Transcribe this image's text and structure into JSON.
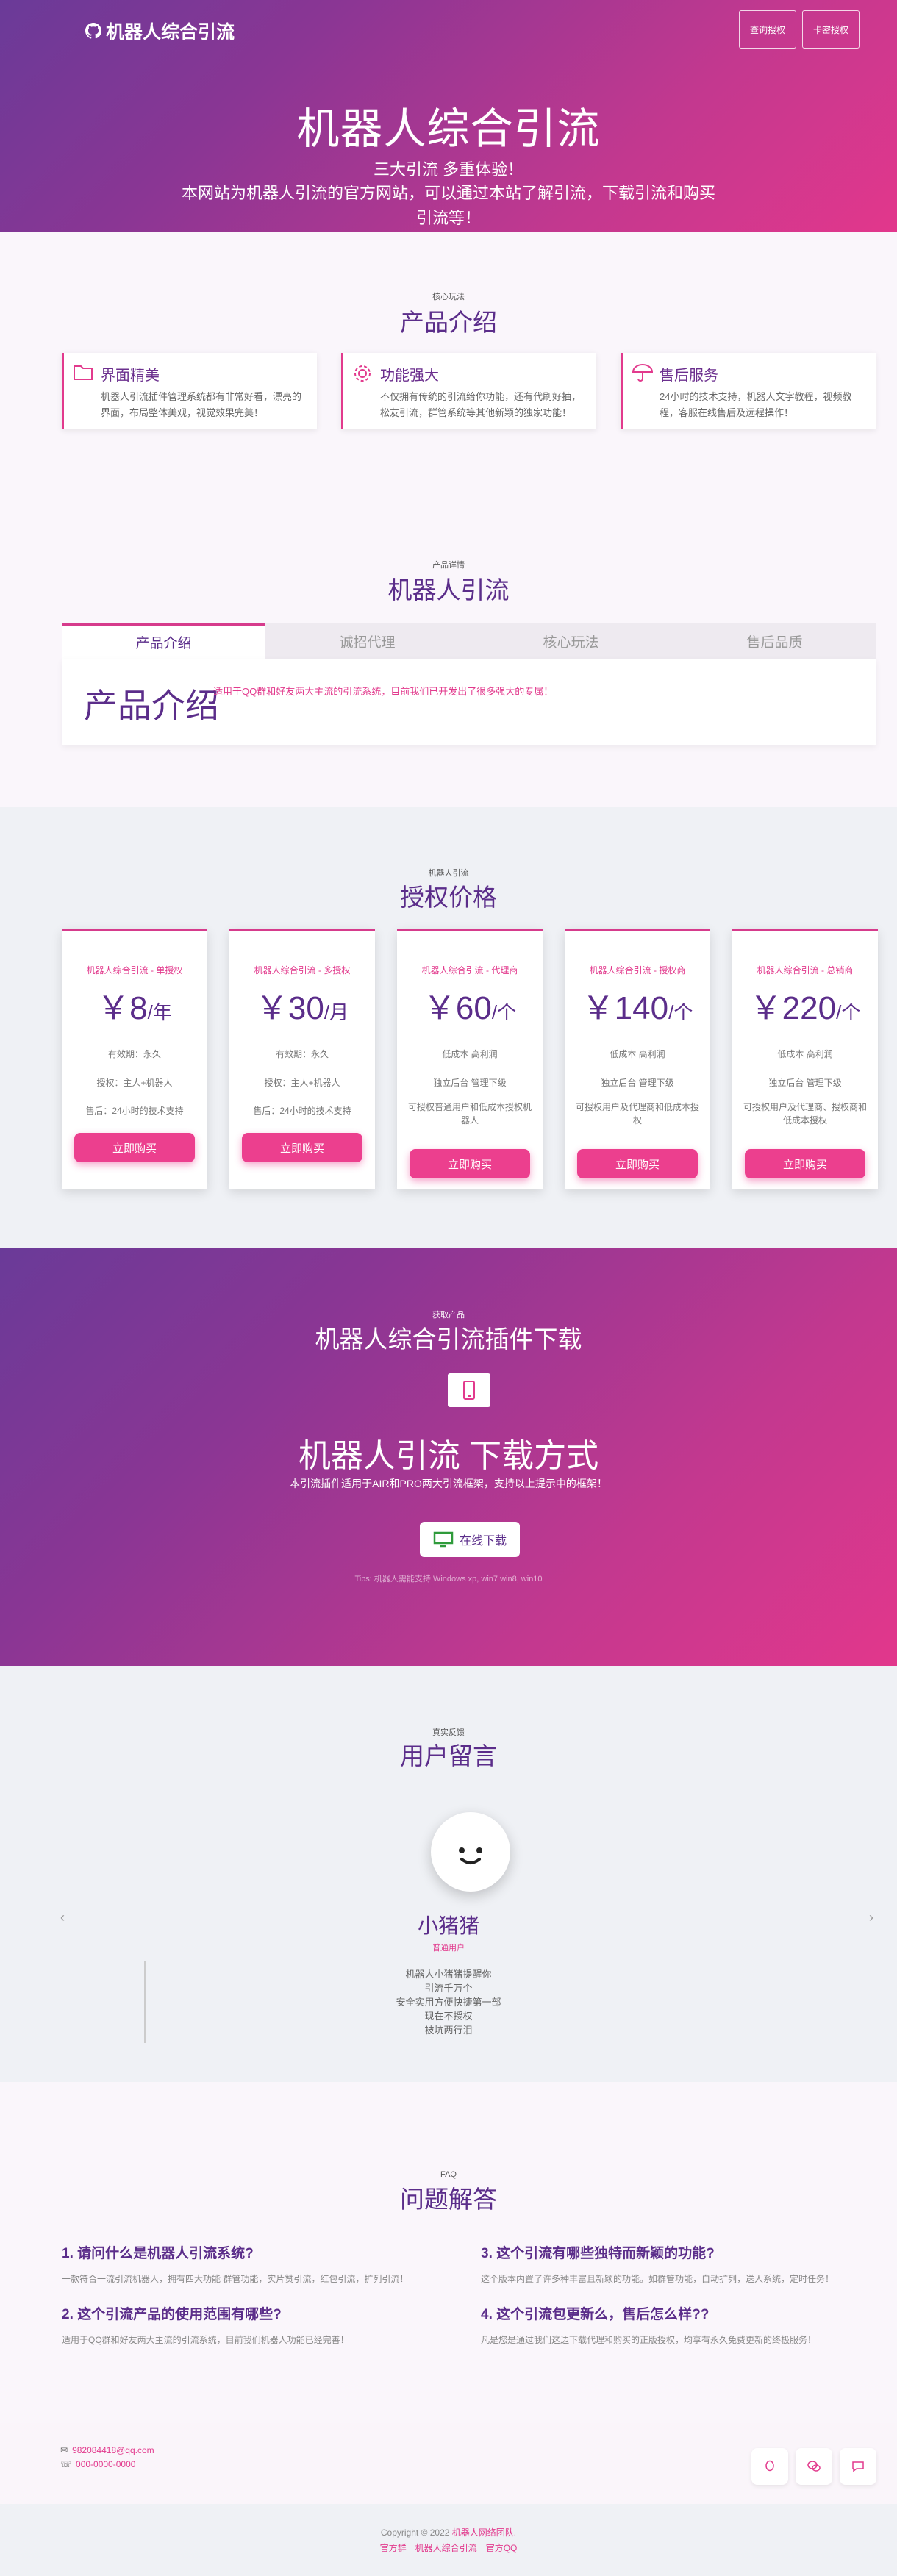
{
  "header": {
    "logo": "机器人综合引流",
    "btn_query": "查询授权",
    "btn_card": "卡密授权",
    "title": "机器人综合引流",
    "subtitle1": "三大引流 多重体验！",
    "subtitle2": "本网站为机器人引流的官方网站，可以通过本站了解引流，下载引流和购买引流等！"
  },
  "product": {
    "kicker": "核心玩法",
    "title": "产品介绍",
    "cards": [
      {
        "icon": "folder-icon",
        "title": "界面精美",
        "text": "机器人引流插件管理系统都有非常好看，漂亮的界面，布局整体美观，视觉效果完美！"
      },
      {
        "icon": "gear-icon",
        "title": "功能强大",
        "text": "不仅拥有传统的引流给你功能，还有代刷好抽，松友引流，群管系统等其他新颖的独家功能！"
      },
      {
        "icon": "umbrella-icon",
        "title": "售后服务",
        "text": "24小时的技术支持，机器人文字教程，视频教程，客服在线售后及远程操作！"
      }
    ]
  },
  "robot": {
    "kicker": "产品详情",
    "title": "机器人引流",
    "tabs": [
      "产品介绍",
      "诚招代理",
      "核心玩法",
      "售后品质"
    ],
    "panel_title": "产品介绍",
    "panel_text": "适用于QQ群和好友两大主流的引流系统，目前我们已开发出了很多强大的专属！"
  },
  "pricing": {
    "kicker": "机器人引流",
    "title": "授权价格",
    "buy_label": "立即购买",
    "plans": [
      {
        "name": "机器人综合引流 - 单授权",
        "price": "￥8",
        "unit": "/年",
        "features": [
          "有效期：永久",
          "授权：主人+机器人",
          "售后：24小时的技术支持"
        ]
      },
      {
        "name": "机器人综合引流 - 多授权",
        "price": "￥30",
        "unit": "/月",
        "features": [
          "有效期：永久",
          "授权：主人+机器人",
          "售后：24小时的技术支持"
        ]
      },
      {
        "name": "机器人综合引流 - 代理商",
        "price": "￥60",
        "unit": "/个",
        "features": [
          "低成本 高利润",
          "独立后台 管理下级",
          "可授权普通用户和低成本授权机器人"
        ]
      },
      {
        "name": "机器人综合引流 - 授权商",
        "price": "￥140",
        "unit": "/个",
        "features": [
          "低成本 高利润",
          "独立后台 管理下级",
          "可授权用户及代理商和低成本授权"
        ]
      },
      {
        "name": "机器人综合引流 - 总销商",
        "price": "￥220",
        "unit": "/个",
        "features": [
          "低成本 高利润",
          "独立后台 管理下级",
          "可授权用户及代理商、授权商和低成本授权"
        ]
      }
    ]
  },
  "download": {
    "kicker": "获取产品",
    "title": "机器人综合引流插件下载",
    "heading": "机器人引流 下载方式",
    "desc": "本引流插件适用于AIR和PRO两大引流框架，支持以上提示中的框架！",
    "btn": "在线下载",
    "tips": "Tips: 机器人需能支持 Windows xp, win7 win8, win10"
  },
  "messages": {
    "kicker": "真实反馈",
    "title": "用户留言",
    "name": "小猪猪",
    "role": "普通用户",
    "lines": [
      "机器人小猪猪提醒你",
      "引流千万个",
      "安全实用方便快捷第一部",
      "现在不授权",
      "被坑两行泪"
    ]
  },
  "faq": {
    "kicker": "FAQ",
    "title": "问题解答",
    "items": [
      {
        "q": "1. 请问什么是机器人引流系统?",
        "a": "一款符合一流引流机器人，拥有四大功能 群管功能，实片赞引流，红包引流，扩列引流！"
      },
      {
        "q": "3. 这个引流有哪些独特而新颖的功能?",
        "a": "这个版本内置了许多种丰富且新颖的功能。如群管功能，自动扩列，送人系统，定时任务！"
      },
      {
        "q": "2. 这个引流产品的使用范围有哪些?",
        "a": "适用于QQ群和好友两大主流的引流系统，目前我们机器人功能已经完善！"
      },
      {
        "q": "4. 这个引流包更新么，售后怎么样??",
        "a": "凡是您是通过我们这边下载代理和购买的正版授权，均享有永久免费更新的终极服务！"
      }
    ]
  },
  "footer": {
    "email": "982084418@qq.com",
    "phone": "000-0000-0000",
    "copyright": "Copyright © 2022 ",
    "copyright_link": "机器人网络团队.",
    "links": [
      "官方群",
      "机器人综合引流",
      "官方QQ"
    ]
  },
  "colors": {
    "accent": "#e23a8d",
    "purple": "#5b2d8a"
  }
}
